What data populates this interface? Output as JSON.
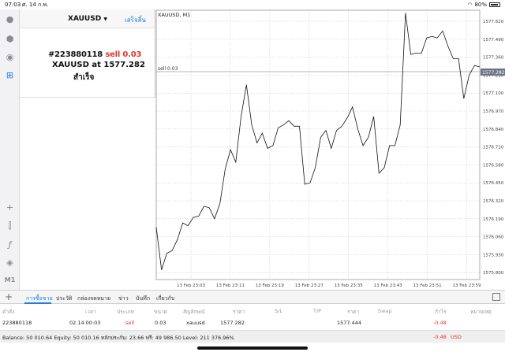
{
  "status_bar": {
    "time": "07:03",
    "date": "ศ. 14 ก.พ.",
    "battery": "80%"
  },
  "panel": {
    "symbol": "XAUUSD",
    "done_label": "เสร็จสิ้น",
    "order_number": "#223880118",
    "order_side": "sell 0.03",
    "price_line": "XAUUSD at",
    "price": "1577.282",
    "status": "สำเร็จ"
  },
  "rail": {
    "timeframe_label": "M1"
  },
  "chart": {
    "title": "XAUUSD, M1",
    "order_line_label": "sell 0.03",
    "current_price": "1577.282"
  },
  "chart_data": {
    "type": "line",
    "title": "XAUUSD, M1",
    "y_ticks": [
      "1577.620",
      "1577.490",
      "1577.360",
      "1577.230",
      "1577.100",
      "1576.970",
      "1576.840",
      "1576.710",
      "1576.580",
      "1576.450",
      "1576.320",
      "1576.190",
      "1576.060",
      "1575.930",
      "1575.800"
    ],
    "x_ticks": [
      "13 Feb 23:03",
      "13 Feb 23:11",
      "13 Feb 23:19",
      "13 Feb 23:27",
      "13 Feb 23:35",
      "13 Feb 23:43",
      "13 Feb 23:51",
      "13 Feb 23:59"
    ],
    "ylim": [
      1575.75,
      1577.7
    ],
    "x": [
      0,
      1,
      2,
      3,
      4,
      5,
      6,
      7,
      8,
      9,
      10,
      11,
      12,
      13,
      14,
      15,
      16,
      17,
      18,
      19,
      20,
      21,
      22,
      23,
      24,
      25,
      26,
      27,
      28,
      29,
      30,
      31,
      32,
      33,
      34,
      35,
      36,
      37,
      38,
      39,
      40,
      41,
      42,
      43,
      44,
      45,
      46,
      47,
      48,
      49,
      50,
      51,
      52,
      53,
      54,
      55,
      56,
      57,
      58,
      59,
      60,
      61,
      62,
      63,
      64,
      65,
      66,
      67,
      68,
      69,
      70
    ],
    "values": [
      1576.13,
      1575.82,
      1575.94,
      1575.96,
      1576.04,
      1576.16,
      1576.14,
      1576.2,
      1576.21,
      1576.28,
      1576.27,
      1576.19,
      1576.3,
      1576.55,
      1576.69,
      1576.6,
      1576.93,
      1577.16,
      1576.87,
      1576.74,
      1576.81,
      1576.7,
      1576.72,
      1576.85,
      1576.87,
      1576.9,
      1576.86,
      1576.86,
      1576.44,
      1576.45,
      1576.56,
      1576.78,
      1576.83,
      1576.7,
      1576.83,
      1576.86,
      1576.92,
      1577.0,
      1576.84,
      1576.72,
      1576.78,
      1576.93,
      1576.52,
      1576.56,
      1576.72,
      1576.72,
      1576.87,
      1577.68,
      1577.38,
      1577.39,
      1577.39,
      1577.5,
      1577.51,
      1577.5,
      1577.55,
      1577.44,
      1577.35,
      1577.35,
      1577.06,
      1577.23,
      1577.3,
      1577.29
    ]
  },
  "tabs": [
    "การซื้อขาย",
    "ประวัติ",
    "กล่องจดหมาย",
    "ข่าว",
    "บันทึก",
    "เกี่ยวกับ"
  ],
  "table": {
    "headers": [
      "คำสั่ง",
      "เวลา",
      "ประเภท",
      "ขนาด",
      "สัญลักษณ์",
      "ราคา",
      "S/L",
      "T/P",
      "ราคา",
      "Swap",
      "กำไร",
      "หมายเหตุ"
    ],
    "row": {
      "order": "223880118",
      "time": "02.14 00:03",
      "type": "sell",
      "size": "0.03",
      "symbol": "xauusd",
      "price": "1577.282",
      "current_price": "1577.444",
      "profit": "-0.48"
    }
  },
  "footer": {
    "summary": "Balance: 50 010.64 Equity: 50 010.16 หลักประกัน: 23.66 ฟรี: 49 986.50 Level: 211 376.96%",
    "profit": "-0.48",
    "currency": "USD"
  },
  "colors": {
    "accent": "#1d7fe0",
    "sell": "#e0352b"
  }
}
